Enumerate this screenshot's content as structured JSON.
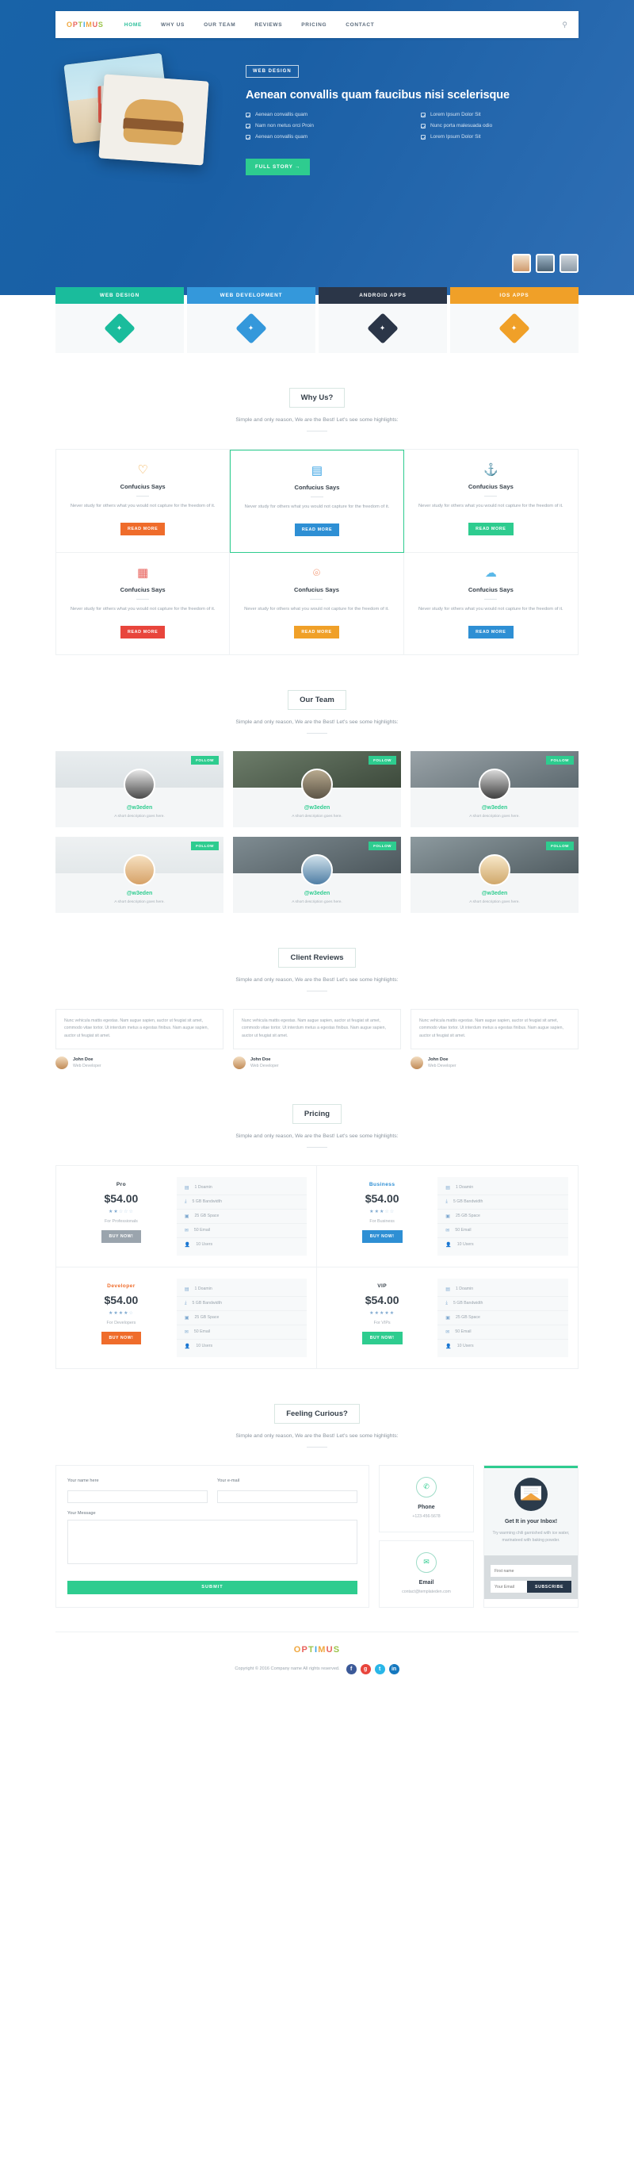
{
  "nav": {
    "logo": "OPTIMUS",
    "links": [
      {
        "label": "HOME",
        "active": true
      },
      {
        "label": "WHY US",
        "active": false
      },
      {
        "label": "OUR TEAM",
        "active": false
      },
      {
        "label": "REVIEWS",
        "active": false
      },
      {
        "label": "PRICING",
        "active": false
      },
      {
        "label": "CONTACT",
        "active": false
      }
    ],
    "search_icon": "search-icon"
  },
  "hero": {
    "badge": "WEB DESIGN",
    "title": "Aenean convallis quam faucibus nisi scelerisque",
    "list_left": [
      "Aenean convallis quam",
      "Nam non metus orci Proin",
      "Aenean convallis quam"
    ],
    "list_right": [
      "Lorem Ipsum Dolor Sit",
      "Nunc porta malesuada odio",
      "Lorem Ipsum Dolor Sit"
    ],
    "cta": "FULL STORY →"
  },
  "services": [
    {
      "label": "WEB DESIGN",
      "color": "#1abc9c",
      "icon": "✦"
    },
    {
      "label": "WEB DEVELOPMENT",
      "color": "#3498db",
      "icon": "✦"
    },
    {
      "label": "ANDROID APPS",
      "color": "#2b3648",
      "icon": "✦"
    },
    {
      "label": "IOS APPS",
      "color": "#f0a028",
      "icon": "✦"
    }
  ],
  "why_us": {
    "title": "Why Us?",
    "subtitle": "Simple and only reason, We are the Best! Let's see some highlights:",
    "cards": [
      {
        "icon": "♡",
        "icon_name": "heart-icon",
        "icon_color": "#f0a73e",
        "title": "Confucius Says",
        "text": "Never study for others what you would not capture for the freedom of it.",
        "btn": "READ MORE",
        "btn_color": "#ef6c2b",
        "highlight": false
      },
      {
        "icon": "▤",
        "icon_name": "database-icon",
        "icon_color": "#3aa3e3",
        "title": "Confucius Says",
        "text": "Never study for others what you would not capture for the freedom of it.",
        "btn": "READ MORE",
        "btn_color": "#2e8fd4",
        "highlight": true
      },
      {
        "icon": "⚓",
        "icon_name": "anchor-icon",
        "icon_color": "#2ecc8f",
        "title": "Confucius Says",
        "text": "Never study for others what you would not capture for the freedom of it.",
        "btn": "READ MORE",
        "btn_color": "#2ecc8f",
        "highlight": false
      },
      {
        "icon": "▦",
        "icon_name": "book-icon",
        "icon_color": "#e8625c",
        "title": "Confucius Says",
        "text": "Never study for others what you would not capture for the freedom of it.",
        "btn": "READ MORE",
        "btn_color": "#e8453c",
        "highlight": false
      },
      {
        "icon": "⌾",
        "icon_name": "headphones-icon",
        "icon_color": "#f07a4b",
        "title": "Confucius Says",
        "text": "Never study for others what you would not capture for the freedom of it.",
        "btn": "READ MORE",
        "btn_color": "#f0a028",
        "highlight": false
      },
      {
        "icon": "☁",
        "icon_name": "cloud-icon",
        "icon_color": "#5bb8e8",
        "title": "Confucius Says",
        "text": "Never study for others what you would not capture for the freedom of it.",
        "btn": "READ MORE",
        "btn_color": "#2e8fd4",
        "highlight": false
      }
    ]
  },
  "team": {
    "title": "Our Team",
    "subtitle": "Simple and only reason, We are the Best! Let's see some highlights:",
    "follow_label": "FOLLOW",
    "members": [
      {
        "handle": "@w3eden",
        "desc": "A short description goes here."
      },
      {
        "handle": "@w3eden",
        "desc": "A short description goes here."
      },
      {
        "handle": "@w3eden",
        "desc": "A short description goes here."
      },
      {
        "handle": "@w3eden",
        "desc": "A short description goes here."
      },
      {
        "handle": "@w3eden",
        "desc": "A short description goes here."
      },
      {
        "handle": "@w3eden",
        "desc": "A short description goes here."
      }
    ]
  },
  "reviews": {
    "title": "Client Reviews",
    "subtitle": "Simple and only reason, We are the Best! Let's see some highlights:",
    "items": [
      {
        "quote": "Nunc vehicula mattis egestas. Nam augue sapien, auctor ut feugiat sit amet, commodo vitae tortor. Ut interdum metus a egestas finibus. Nam augue sapien, auctor ut feugiat sit amet.",
        "name": "John Doe",
        "role": "Web Developer"
      },
      {
        "quote": "Nunc vehicula mattis egestas. Nam augue sapien, auctor ut feugiat sit amet, commodo vitae tortor. Ut interdum metus a egestas finibus. Nam augue sapien, auctor ut feugiat sit amet.",
        "name": "John Doe",
        "role": "Web Developer"
      },
      {
        "quote": "Nunc vehicula mattis egestas. Nam augue sapien, auctor ut feugiat sit amet, commodo vitae tortor. Ut interdum metus a egestas finibus. Nam augue sapien, auctor ut feugiat sit amet.",
        "name": "John Doe",
        "role": "Web Developer"
      }
    ]
  },
  "pricing": {
    "title": "Pricing",
    "subtitle": "Simple and only reason, We are the Best! Let's see some highlights:",
    "buy_label": "BUY NOW!",
    "plans": [
      {
        "name": "Pro",
        "name_color": "#36404a",
        "price": "$54.00",
        "stars_filled": 2,
        "for": "For Professionals",
        "btn_color": "#9aa4ad",
        "features": [
          "1 Doamin",
          "5 GB Bandwidth",
          "25 GB Space",
          "50 Email",
          "10 Users"
        ]
      },
      {
        "name": "Business",
        "name_color": "#2e8fd4",
        "price": "$54.00",
        "stars_filled": 3,
        "for": "For Business",
        "btn_color": "#2e8fd4",
        "features": [
          "1 Doamin",
          "5 GB Bandwidth",
          "25 GB Space",
          "50 Email",
          "10 Users"
        ]
      },
      {
        "name": "Developer",
        "name_color": "#ef6c2b",
        "price": "$54.00",
        "stars_filled": 4,
        "for": "For Developers",
        "btn_color": "#ef6c2b",
        "features": [
          "1 Doamin",
          "5 GB Bandwidth",
          "25 GB Space",
          "50 Email",
          "10 Users"
        ]
      },
      {
        "name": "VIP",
        "name_color": "#36404a",
        "price": "$54.00",
        "stars_filled": 5,
        "for": "For VIPs",
        "btn_color": "#2ecc8f",
        "features": [
          "1 Doamin",
          "5 GB Bandwidth",
          "25 GB Space",
          "50 Email",
          "10 Users"
        ]
      }
    ],
    "feature_icons": [
      "domain-icon",
      "bandwidth-icon",
      "space-icon",
      "email-icon",
      "users-icon"
    ]
  },
  "contact": {
    "title": "Feeling Curious?",
    "subtitle": "Simple and only reason, We are the Best! Let's see some highlights:",
    "form": {
      "name_label": "Your name here",
      "name_value": "",
      "email_label": "Your e-mail",
      "email_value": "",
      "message_label": "Your Message",
      "message_value": "",
      "submit": "SUBMIT"
    },
    "info": [
      {
        "icon": "phone-icon",
        "glyph": "✆",
        "title": "Phone",
        "value": "+123-456-5678"
      },
      {
        "icon": "envelope-icon",
        "glyph": "✉",
        "title": "Email",
        "value": "contact@templateden.com"
      }
    ],
    "newsletter": {
      "title": "Get It in your Inbox!",
      "text": "Try warming chili garnished with ice water, marinateed with baking powder.",
      "first_name_placeholder": "First name",
      "email_placeholder": "Your Email",
      "subscribe": "SUBSCRIBE"
    }
  },
  "footer": {
    "logo": "OPTIMUS",
    "copyright": "Copyright © 2016 Company name All rights reserved.",
    "socials": [
      {
        "name": "facebook-icon",
        "glyph": "f",
        "color": "#3b5998"
      },
      {
        "name": "google-plus-icon",
        "glyph": "g",
        "color": "#e8453c"
      },
      {
        "name": "twitter-icon",
        "glyph": "t",
        "color": "#29b6e8"
      },
      {
        "name": "linkedin-icon",
        "glyph": "in",
        "color": "#1578bf"
      }
    ]
  }
}
